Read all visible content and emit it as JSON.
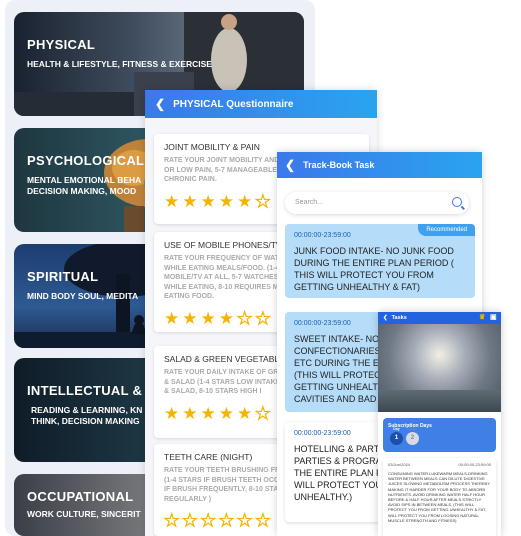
{
  "categories": [
    {
      "title": "PHYSICAL",
      "subtitle": "HEALTH & LIFESTYLE, FITNESS & EXERCISE"
    },
    {
      "title": "PSYCHOLOGICAL",
      "subtitle": "MENTAL EMOTIONAL BEHA\nDECISION MAKING, MOOD"
    },
    {
      "title": "SPIRITUAL",
      "subtitle": "MIND BODY SOUL, MEDITA"
    },
    {
      "title": "INTELLECTUAL & E",
      "subtitle": "READING & LEARNING, KN\nTHINK, DECISION MAKING"
    },
    {
      "title": "OCCUPATIONAL",
      "subtitle": "WORK CULTURE, SINCERIT"
    }
  ],
  "questionnaire": {
    "title": "PHYSICAL Questionnaire",
    "questions": [
      {
        "title": "JOINT MOBILITY & PAIN",
        "desc": "RATE YOUR JOINT MOBILITY AND\nOR LOW PAIN, 5-7 MANAGEABLE P\nCHRONIC PAIN.",
        "rating": 5
      },
      {
        "title": "USE OF MOBILE PHONES/TV D",
        "desc": "RATE YOUR FREQUENCY OF WATCH\nWHILE EATING MEALS/FOOD. (1-4\nMOBILE/TV AT ALL, 5-7 WATCHES\nWHILE EATING, 8-10 REQUIRES MO\nEATING FOOD.",
        "rating": 4
      },
      {
        "title": "SALAD & GREEN VEGETABLE I",
        "desc": "RATE YOUR DAILY INTAKE OF GREE\n& SALAD (1-4 STARS LOW INTAKE,\n& SALAD, 8-10 STARS HIGH I",
        "rating": 5
      },
      {
        "title": "TEETH CARE (NIGHT)",
        "desc": "RATE YOUR TEETH BRUSHING FREC\n(1-4 STARS IF BRUSH TEETH OCCA\nIF BRUSH FREQUENTLY, 8-10 STAR\nREGULARLY )",
        "rating": 0
      }
    ]
  },
  "trackbook": {
    "title": "Track-Book Task",
    "search_placeholder": "Search...",
    "tasks": [
      {
        "time": "00:00:00-23:59:00",
        "badge": "Recommended",
        "text": "JUNK FOOD INTAKE- NO JUNK FOOD DURING THE ENTIRE PLAN PERIOD ( THIS WILL PROTECT YOU FROM GETTING UNHEALTHY & FAT)"
      },
      {
        "time": "00:00:00-23:59:00",
        "badge": "",
        "text": "SWEET INTAKE- NO\nCONFECTIONARIES\nETC DURING THE E\n(THIS WILL PROTEC\nGETTING UNHEALTH\nCAVITIES AND BAD"
      },
      {
        "time": "00:00:00-23:59:00",
        "badge": "",
        "text": "HOTELLING & PARTI\nPARTIES & PROGRA\nTHE ENTIRE PLAN PI\nWILL PROTECT YOU\nUNHEALTHY.)"
      }
    ]
  },
  "tasks_panel": {
    "title": "Tasks",
    "sub_title": "Subscription Days",
    "days": [
      {
        "label": "Day",
        "num": "1"
      },
      {
        "label": "Day",
        "num": "2"
      }
    ],
    "entry_date": "03/Jun/2024",
    "entry_time": "00:00:00-23:59:00",
    "entry_text": "CONSUMING WATER LUKEWARM MEALS-DRINKING WATER BETWEEN MEALS CAN DILUTE DIGESTIVE JUICES SLOWING METABOLISM PROCESS THEREBY MAKING IT HARDER FOR YOUR BODY TO ABSORB NUTRIENTS. AVOID DRINKING WATER HALF HOUR BEFORE & HALF HOUR AFTER MEALS STRICTLY AVOID SIPS IN BETWEEN MEALS. (THIS WILL PROTECT YOU FROM GETTING UNHEALTHY & FAT, WILL PROTECT YOU FROM LOOSING NATURAL MUSCLE STRENGTH AND FITNESS)"
  },
  "colors": {
    "accent": "#3c78ea",
    "star": "#f4b400",
    "task_blue": "#b5ddf9"
  }
}
